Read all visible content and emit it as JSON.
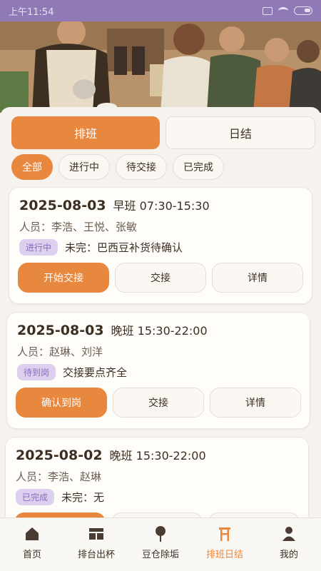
{
  "status_bar": {
    "time": "上午11:54"
  },
  "segments": {
    "schedule": "排班",
    "daily": "日结"
  },
  "filters": [
    "全部",
    "进行中",
    "待交接",
    "已完成"
  ],
  "cards": [
    {
      "date": "2025-08-03",
      "shift": "早班 07:30-15:30",
      "people": "人员：李浩、王悦、张敏",
      "badge": "进行中",
      "note": "未完：巴西豆补货待确认",
      "actions": [
        "开始交接",
        "交接",
        "详情"
      ]
    },
    {
      "date": "2025-08-03",
      "shift": "晚班 15:30-22:00",
      "people": "人员：赵琳、刘洋",
      "badge": "待到岗",
      "note": "交接要点齐全",
      "actions": [
        "确认到岗",
        "交接",
        "详情"
      ]
    },
    {
      "date": "2025-08-02",
      "shift": "晚班 15:30-22:00",
      "people": "人员：李浩、赵琳",
      "badge": "已完成",
      "note": "未完：无",
      "actions": [
        "",
        "",
        ""
      ]
    }
  ],
  "bottom_nav": [
    {
      "label": "首页",
      "icon": "home-icon"
    },
    {
      "label": "排台出杯",
      "icon": "counter-icon"
    },
    {
      "label": "豆仓除垢",
      "icon": "pin-icon"
    },
    {
      "label": "排班日结",
      "icon": "schedule-icon"
    },
    {
      "label": "我的",
      "icon": "user-icon"
    }
  ],
  "colors": {
    "accent": "#e8883f",
    "status_bar": "#8f7ab5",
    "badge_bg": "#ddd0ee"
  }
}
